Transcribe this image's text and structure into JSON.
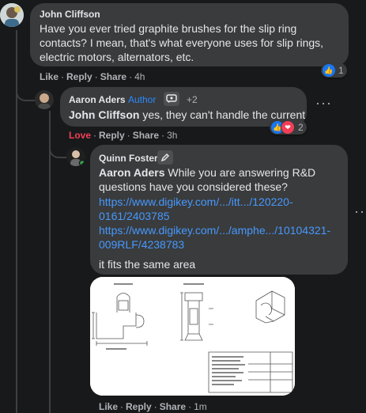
{
  "comments": [
    {
      "author": "John Cliffson",
      "lines": [
        "Have you ever tried graphite brushes for the slip ring",
        "contacts? I mean, that's what everyone uses for slip rings,",
        "electric motors, alternators, etc."
      ],
      "actions": {
        "like": "Like",
        "reply": "Reply",
        "share": "Share",
        "time": "4h"
      },
      "reaction_count": "1"
    },
    {
      "author": "Aaron Aders",
      "badge": "Author",
      "badge_extra": "+2",
      "mention": "John Cliffson",
      "text": " yes, they can't handle the current",
      "actions": {
        "reacted": "Love",
        "reply": "Reply",
        "share": "Share",
        "time": "3h"
      },
      "reaction_count": "2"
    },
    {
      "author": "Quinn Foster",
      "mention": "Aaron Aders",
      "text_line1": " While you are answering R&D",
      "text_line2": "questions have you considered these?",
      "link1_line1": "https://www.digikey.com/.../itt.../120220-",
      "link1_line2": "0161/2403785",
      "link2_line1": "https://www.digikey.com/.../amphe.../10104321-",
      "link2_line2": "009RLF/4238783",
      "closing": "it fits the same area",
      "actions": {
        "like": "Like",
        "reply": "Reply",
        "share": "Share",
        "time": "1m"
      }
    }
  ],
  "separator": "·",
  "colors": {
    "bg": "#18191a",
    "bubble": "#3a3b3c",
    "link": "#4599ff",
    "love": "#f33e58",
    "like": "#1877f2"
  },
  "icons": [
    "more-dots-icon",
    "like-reaction-icon",
    "love-reaction-icon",
    "rising-fan-icon",
    "pencil-icon"
  ]
}
